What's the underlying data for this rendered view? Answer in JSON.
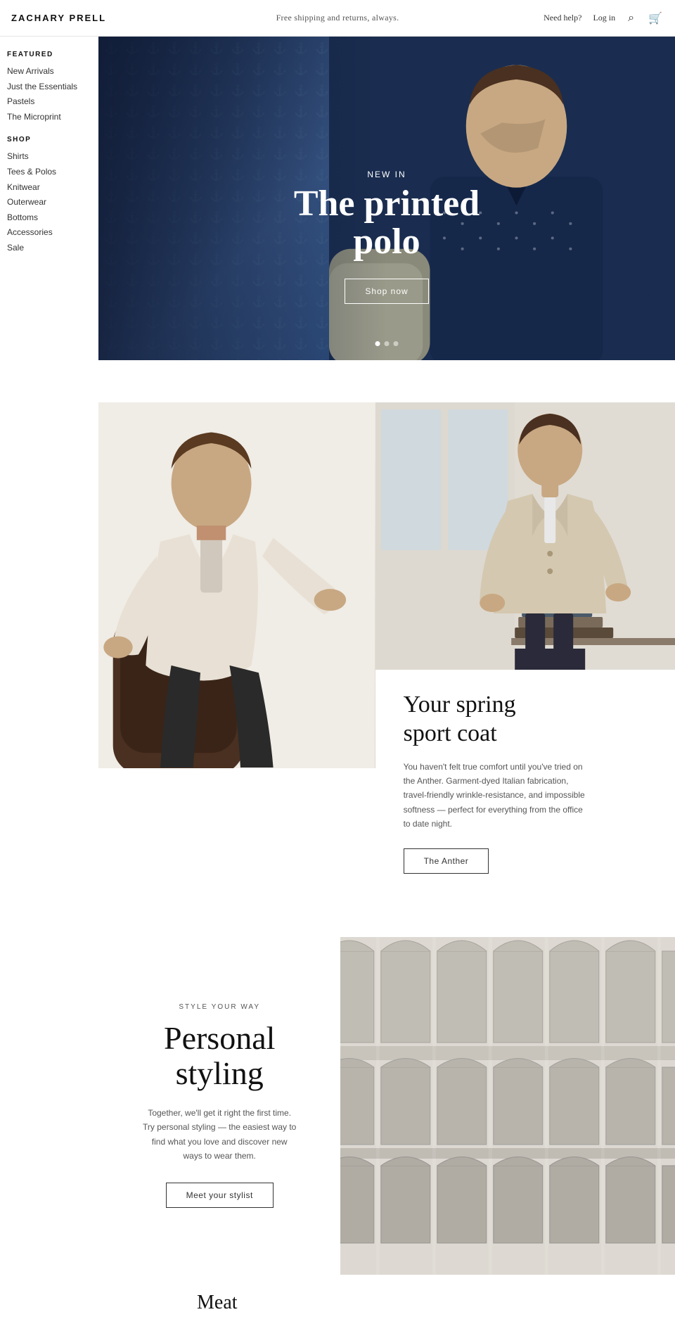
{
  "header": {
    "logo": "ZACHARY PRELL",
    "shipping_msg": "Free shipping and returns, always.",
    "help_label": "Need help?",
    "login_label": "Log in",
    "search_icon": "🔍",
    "cart_icon": "🛒"
  },
  "sidebar": {
    "featured_heading": "FEATURED",
    "featured_items": [
      {
        "label": "New Arrivals",
        "href": "#"
      },
      {
        "label": "Just the Essentials",
        "href": "#"
      },
      {
        "label": "Pastels",
        "href": "#"
      },
      {
        "label": "The Microprint",
        "href": "#"
      }
    ],
    "shop_heading": "SHOP",
    "shop_items": [
      {
        "label": "Shirts",
        "href": "#"
      },
      {
        "label": "Tees & Polos",
        "href": "#"
      },
      {
        "label": "Knitwear",
        "href": "#"
      },
      {
        "label": "Outerwear",
        "href": "#"
      },
      {
        "label": "Bottoms",
        "href": "#"
      },
      {
        "label": "Accessories",
        "href": "#"
      },
      {
        "label": "Sale",
        "href": "#"
      }
    ]
  },
  "hero": {
    "subtitle": "NEW IN",
    "title_line1": "The printed",
    "title_line2": "polo",
    "cta_label": "Shop now",
    "dot_count": 3,
    "active_dot": 0
  },
  "sport_coat": {
    "eyebrow": "",
    "title_line1": "Your spring",
    "title_line2": "sport coat",
    "description": "You haven't felt true comfort until you've tried on the Anther. Garment-dyed Italian fabrication, travel-friendly wrinkle-resistance, and impossible softness — perfect for everything from the office to date night.",
    "cta_label": "The Anther"
  },
  "personal_styling": {
    "eyebrow": "STYLE YOUR WAY",
    "title_line1": "Personal",
    "title_line2": "styling",
    "description": "Together, we'll get it right the first time. Try personal styling — the easiest way to find what you love and discover new ways to wear them.",
    "cta_label": "Meet your stylist"
  },
  "bottom": {
    "category_text": "Meat"
  }
}
